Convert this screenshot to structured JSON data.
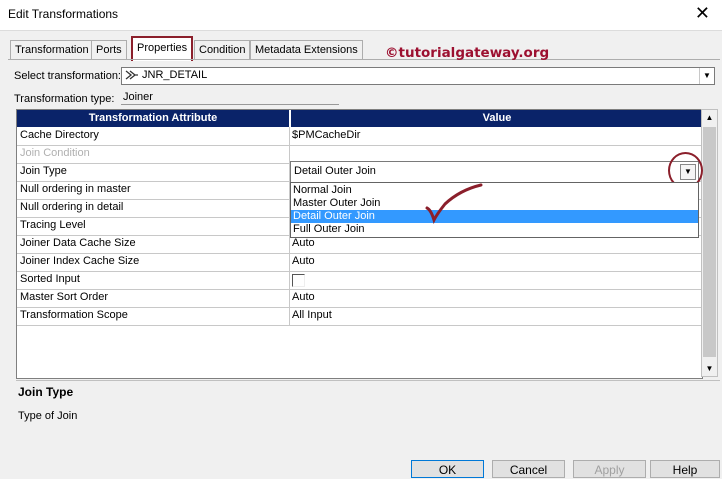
{
  "window": {
    "title": "Edit Transformations",
    "close_glyph": "✕"
  },
  "tabs": [
    {
      "label": "Transformation",
      "active": false
    },
    {
      "label": "Ports",
      "active": false
    },
    {
      "label": "Properties",
      "active": true
    },
    {
      "label": "Condition",
      "active": false
    },
    {
      "label": "Metadata Extensions",
      "active": false
    }
  ],
  "watermark": "©tutorialgateway.org",
  "select_transformation": {
    "label": "Select transformation:",
    "value": "JNR_DETAIL",
    "icon": "joiner-icon"
  },
  "transformation_type": {
    "label": "Transformation type:",
    "value": "Joiner"
  },
  "grid": {
    "headers": {
      "attribute": "Transformation Attribute",
      "value": "Value"
    },
    "rows": [
      {
        "attr": "Cache Directory",
        "value": "$PMCacheDir"
      },
      {
        "attr": "Join Condition",
        "value": ""
      },
      {
        "attr": "Join Type",
        "value": ""
      },
      {
        "attr": "Null ordering in master",
        "value": ""
      },
      {
        "attr": "Null ordering in detail",
        "value": ""
      },
      {
        "attr": "Tracing Level",
        "value": ""
      },
      {
        "attr": "Joiner Data Cache Size",
        "value": "Auto"
      },
      {
        "attr": "Joiner Index Cache Size",
        "value": "Auto"
      },
      {
        "attr": "Sorted Input",
        "value": ""
      },
      {
        "attr": "Master Sort Order",
        "value": "Auto"
      },
      {
        "attr": "Transformation Scope",
        "value": "All Input"
      }
    ]
  },
  "join_type_dropdown": {
    "selected": "Detail Outer Join",
    "options": [
      "Normal Join",
      "Master Outer Join",
      "Detail Outer Join",
      "Full Outer Join"
    ],
    "highlighted_index": 2,
    "highlight_color": "#3399ff"
  },
  "description": {
    "title": "Join Type",
    "text": "Type of Join"
  },
  "buttons": {
    "ok": "OK",
    "cancel": "Cancel",
    "apply": "Apply",
    "help": "Help"
  },
  "colors": {
    "header_bg": "#0a2369",
    "annotation": "#8b1f2b"
  }
}
